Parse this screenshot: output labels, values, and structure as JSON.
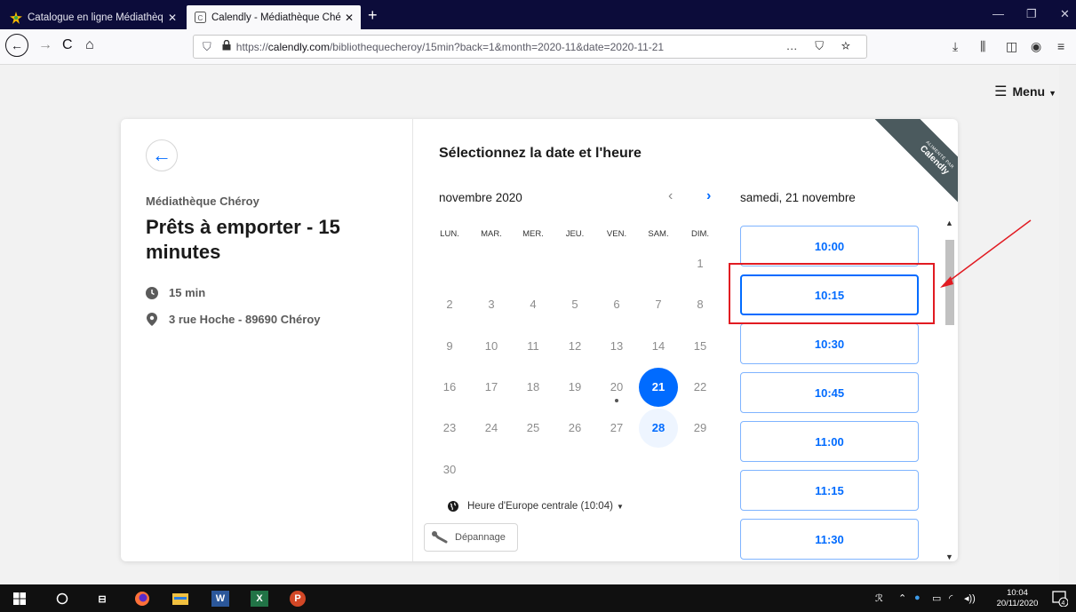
{
  "browser": {
    "tabs": [
      {
        "label": "Catalogue en ligne Médiathèq",
        "active": false
      },
      {
        "label": "Calendly - Médiathèque Chéroy",
        "active": true
      }
    ],
    "url_prefix": "https://",
    "url_domain": "calendly.com",
    "url_path": "/bibliothequecheroy/15min?back=1&month=2020-11&date=2020-11-21",
    "url_more": "…"
  },
  "page": {
    "menu_label": "Menu"
  },
  "event": {
    "organizer": "Médiathèque Chéroy",
    "title": "Prêts à emporter - 15 minutes",
    "duration": "15 min",
    "location": "3 rue Hoche - 89690 Chéroy"
  },
  "calendar": {
    "heading": "Sélectionnez la date et l'heure",
    "month_label": "novembre 2020",
    "selected_day_label": "samedi, 21 novembre",
    "weekdays": [
      "LUN.",
      "MAR.",
      "MER.",
      "JEU.",
      "VEN.",
      "SAM.",
      "DIM."
    ],
    "days": [
      {
        "n": "1",
        "col": 6,
        "row": 0,
        "state": "disabled"
      },
      {
        "n": "2",
        "col": 0,
        "row": 1,
        "state": "disabled"
      },
      {
        "n": "3",
        "col": 1,
        "row": 1,
        "state": "disabled"
      },
      {
        "n": "4",
        "col": 2,
        "row": 1,
        "state": "disabled"
      },
      {
        "n": "5",
        "col": 3,
        "row": 1,
        "state": "disabled"
      },
      {
        "n": "6",
        "col": 4,
        "row": 1,
        "state": "disabled"
      },
      {
        "n": "7",
        "col": 5,
        "row": 1,
        "state": "disabled"
      },
      {
        "n": "8",
        "col": 6,
        "row": 1,
        "state": "disabled"
      },
      {
        "n": "9",
        "col": 0,
        "row": 2,
        "state": "disabled"
      },
      {
        "n": "10",
        "col": 1,
        "row": 2,
        "state": "disabled"
      },
      {
        "n": "11",
        "col": 2,
        "row": 2,
        "state": "disabled"
      },
      {
        "n": "12",
        "col": 3,
        "row": 2,
        "state": "disabled"
      },
      {
        "n": "13",
        "col": 4,
        "row": 2,
        "state": "disabled"
      },
      {
        "n": "14",
        "col": 5,
        "row": 2,
        "state": "disabled"
      },
      {
        "n": "15",
        "col": 6,
        "row": 2,
        "state": "disabled"
      },
      {
        "n": "16",
        "col": 0,
        "row": 3,
        "state": "disabled"
      },
      {
        "n": "17",
        "col": 1,
        "row": 3,
        "state": "disabled"
      },
      {
        "n": "18",
        "col": 2,
        "row": 3,
        "state": "disabled"
      },
      {
        "n": "19",
        "col": 3,
        "row": 3,
        "state": "disabled"
      },
      {
        "n": "20",
        "col": 4,
        "row": 3,
        "state": "today"
      },
      {
        "n": "21",
        "col": 5,
        "row": 3,
        "state": "selected"
      },
      {
        "n": "22",
        "col": 6,
        "row": 3,
        "state": "disabled"
      },
      {
        "n": "23",
        "col": 0,
        "row": 4,
        "state": "disabled"
      },
      {
        "n": "24",
        "col": 1,
        "row": 4,
        "state": "disabled"
      },
      {
        "n": "25",
        "col": 2,
        "row": 4,
        "state": "disabled"
      },
      {
        "n": "26",
        "col": 3,
        "row": 4,
        "state": "disabled"
      },
      {
        "n": "27",
        "col": 4,
        "row": 4,
        "state": "disabled"
      },
      {
        "n": "28",
        "col": 5,
        "row": 4,
        "state": "available"
      },
      {
        "n": "29",
        "col": 6,
        "row": 4,
        "state": "disabled"
      },
      {
        "n": "30",
        "col": 0,
        "row": 5,
        "state": "disabled"
      }
    ],
    "timezone_label": "Heure d'Europe centrale (10:04)",
    "troubleshoot_label": "Dépannage"
  },
  "slots": [
    "10:00",
    "10:15",
    "10:30",
    "10:45",
    "11:00",
    "11:15",
    "11:30"
  ],
  "ribbon": {
    "small": "ALIMENTÉ PAR",
    "brand": "Calendly"
  },
  "taskbar": {
    "time": "10:04",
    "date": "20/11/2020",
    "notification_count": "4"
  },
  "colors": {
    "accent": "#006bff",
    "annotation": "#e11b22"
  }
}
